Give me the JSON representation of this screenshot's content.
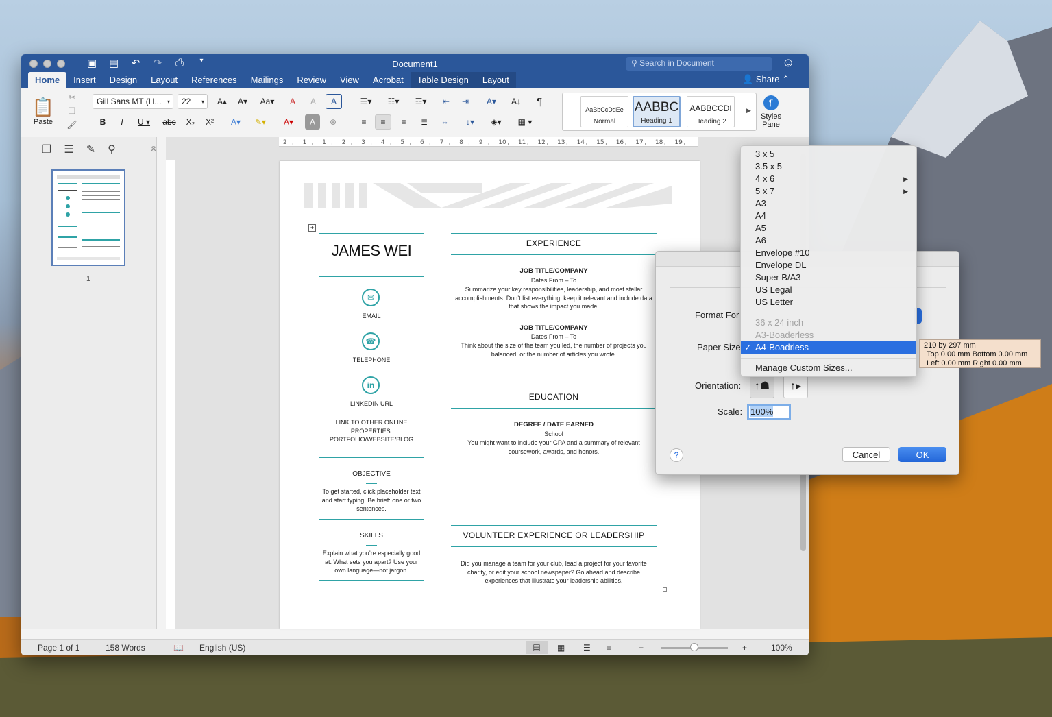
{
  "window": {
    "title": "Document1"
  },
  "search": {
    "placeholder": "Search in Document"
  },
  "tabs": [
    {
      "label": "Home"
    },
    {
      "label": "Insert"
    },
    {
      "label": "Design"
    },
    {
      "label": "Layout"
    },
    {
      "label": "References"
    },
    {
      "label": "Mailings"
    },
    {
      "label": "Review"
    },
    {
      "label": "View"
    },
    {
      "label": "Acrobat"
    },
    {
      "label": "Table Design"
    },
    {
      "label": "Layout"
    }
  ],
  "share": "Share",
  "ribbon": {
    "paste_label": "Paste",
    "font_name": "Gill Sans MT (H...",
    "font_size": "22",
    "styles": [
      {
        "sample": "AaBbCcDdEe",
        "name": "Normal"
      },
      {
        "sample": "AABBC",
        "name": "Heading 1"
      },
      {
        "sample": "AABBCCDI",
        "name": "Heading 2"
      }
    ],
    "styles_pane_line1": "Styles",
    "styles_pane_line2": "Pane"
  },
  "sidebar": {
    "page_number": "1"
  },
  "ruler": {
    "h_ticks": [
      "2",
      "1",
      "1",
      "2",
      "3",
      "4",
      "5",
      "6",
      "7",
      "8",
      "9",
      "10",
      "11",
      "12",
      "13",
      "14",
      "15",
      "16",
      "17",
      "18",
      "19"
    ]
  },
  "document": {
    "name": "JAMES WEI",
    "email": "EMAIL",
    "telephone": "TELEPHONE",
    "linkedin": "LINKEDIN URL",
    "other_links": "LINK TO OTHER ONLINE PROPERTIES: PORTFOLIO/WEBSITE/BLOG",
    "objective_head": "OBJECTIVE",
    "objective_text": "To get started, click placeholder text and start typing. Be brief: one or two sentences.",
    "skills_head": "SKILLS",
    "skills_text": "Explain what you’re especially good at. What sets you apart? Use your own language—not jargon.",
    "experience_head": "EXPERIENCE",
    "job1_title": "JOB TITLE/COMPANY",
    "job1_dates": "Dates From – To",
    "job1_text": "Summarize your key responsibilities, leadership, and most stellar accomplishments. Don’t list everything; keep it relevant and include data that shows the impact you made.",
    "job2_title": "JOB TITLE/COMPANY",
    "job2_dates": "Dates From – To",
    "job2_text": "Think about the size of the team you led, the number of projects you balanced, or the number of articles you wrote.",
    "education_head": "EDUCATION",
    "degree": "DEGREE / DATE EARNED",
    "school": "School",
    "edu_text": "You might want to include your GPA and a summary of relevant coursework, awards, and honors.",
    "volunteer_head": "VOLUNTEER EXPERIENCE OR LEADERSHIP",
    "volunteer_text": "Did you manage a team for your club, lead a project for your favorite charity, or edit your school newspaper? Go ahead and describe experiences that illustrate your leadership abilities."
  },
  "status": {
    "page": "Page 1 of 1",
    "words": "158 Words",
    "language": "English (US)",
    "zoom": "100%",
    "zoom_minus": "−",
    "zoom_plus": "+"
  },
  "dialog": {
    "format_for_label": "Format For",
    "paper_size_label": "Paper Size",
    "orientation_label": "Orientation:",
    "scale_label": "Scale:",
    "scale_value": "100%",
    "help": "?",
    "cancel": "Cancel",
    "ok": "OK"
  },
  "paper_menu": {
    "group1": [
      {
        "label": "3 x 5"
      },
      {
        "label": "3.5 x 5"
      },
      {
        "label": "4 x 6"
      },
      {
        "label": "5 x 7"
      },
      {
        "label": "A3"
      },
      {
        "label": "A4"
      },
      {
        "label": "A5"
      },
      {
        "label": "A6"
      },
      {
        "label": "Envelope #10"
      },
      {
        "label": "Envelope DL"
      },
      {
        "label": "Super B/A3"
      },
      {
        "label": "US Legal"
      },
      {
        "label": "US Letter"
      }
    ],
    "group2": [
      {
        "label": "36 x 24 inch"
      },
      {
        "label": "A3-Boaderless"
      },
      {
        "label": "A4-Boadrless"
      }
    ],
    "selected": "A4-Boadrless",
    "checkmark": "✓",
    "manage": "Manage Custom Sizes..."
  },
  "tooltip": {
    "line1": "210 by 297 mm",
    "line2": "Top 0.00 mm Bottom 0.00 mm",
    "line3": "Left 0.00 mm Right 0.00 mm"
  }
}
